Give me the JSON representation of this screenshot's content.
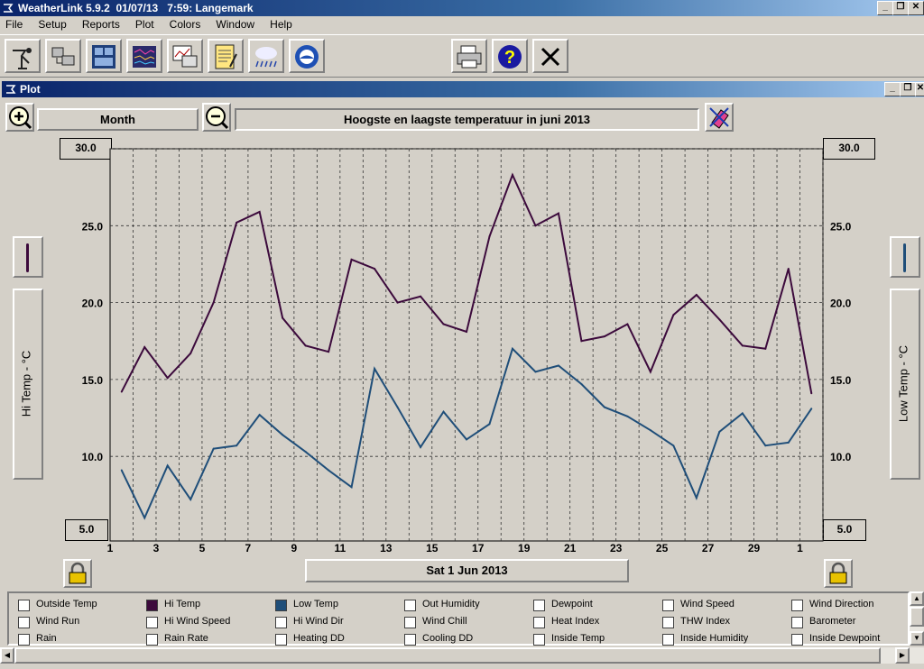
{
  "app": {
    "title": "WeatherLink 5.9.2  01/07/13   7:59: Langemark",
    "min_label": "_",
    "restore_label": "❐",
    "close_label": "✕"
  },
  "menu": [
    "File",
    "Setup",
    "Reports",
    "Plot",
    "Colors",
    "Window",
    "Help"
  ],
  "toolbar_icons": [
    "station-icon",
    "data-download-icon",
    "bulletin-icon",
    "strip-chart-icon",
    "plot-icon",
    "notepad-icon",
    "weather-rain-icon",
    "noaa-icon"
  ],
  "toolbar_right_icons": [
    "printer-icon",
    "help-icon",
    "close-icon"
  ],
  "plot_window": {
    "title": "Plot",
    "period_label": "Month",
    "chart_title": "Hoogste en laagste temperatuur in juni 2013",
    "date_label": "Sat 1 Jun 2013",
    "left_axis_label": "Hi Temp - °C",
    "right_axis_label": "Low Temp - °C"
  },
  "chart_data": {
    "type": "line",
    "title": "Hoogste en laagste temperatuur in juni 2013",
    "x": [
      1.5,
      2.5,
      3.5,
      4.5,
      5.5,
      6.5,
      7.5,
      8.5,
      9.5,
      10.5,
      11.5,
      12.5,
      13.5,
      14.5,
      15.5,
      16.5,
      17.5,
      18.5,
      19.5,
      20.5,
      21.5,
      22.5,
      23.5,
      24.5,
      25.5,
      26.5,
      27.5,
      28.5,
      29.5,
      30.5,
      31.5
    ],
    "xticks": [
      "1",
      "3",
      "5",
      "7",
      "9",
      "11",
      "13",
      "15",
      "17",
      "19",
      "21",
      "23",
      "25",
      "27",
      "29",
      "1"
    ],
    "xtick_positions": [
      1,
      3,
      5,
      7,
      9,
      11,
      13,
      15,
      17,
      19,
      21,
      23,
      25,
      27,
      29,
      31
    ],
    "xlim": [
      1,
      32
    ],
    "ylim": [
      4.5,
      30
    ],
    "yticks": [
      10.0,
      15.0,
      20.0,
      25.0
    ],
    "ybox_top": "30.0",
    "ybox_bottom": "5.0",
    "ylabel_left": "Hi Temp - °C",
    "ylabel_right": "Low Temp - °C",
    "grid": true,
    "series": [
      {
        "name": "Hi Temp",
        "color": "#3c0a3c",
        "values": [
          14.2,
          17.1,
          15.1,
          16.7,
          20.0,
          25.2,
          25.9,
          19.0,
          17.2,
          16.8,
          22.8,
          22.2,
          20.0,
          20.4,
          18.6,
          18.1,
          24.3,
          28.3,
          25.0,
          25.8,
          17.5,
          17.8,
          18.6,
          15.5,
          19.2,
          20.5,
          18.9,
          17.2,
          17.0,
          22.2,
          14.1
        ]
      },
      {
        "name": "Low Temp",
        "color": "#1f4e79",
        "values": [
          9.1,
          6.0,
          9.4,
          7.2,
          10.5,
          10.7,
          12.7,
          11.4,
          10.3,
          9.1,
          8.0,
          15.7,
          13.2,
          10.6,
          12.9,
          11.1,
          12.1,
          17.0,
          15.5,
          15.9,
          14.7,
          13.2,
          12.6,
          11.7,
          10.7,
          7.3,
          11.6,
          12.8,
          10.7,
          10.9,
          13.1
        ]
      }
    ]
  },
  "legend": [
    {
      "label": "Outside Temp",
      "checked": false,
      "color": ""
    },
    {
      "label": "Hi Temp",
      "checked": true,
      "color": "#3c0a3c"
    },
    {
      "label": "Low Temp",
      "checked": true,
      "color": "#1f4e79"
    },
    {
      "label": "Out Humidity",
      "checked": false,
      "color": ""
    },
    {
      "label": "Dewpoint",
      "checked": false,
      "color": ""
    },
    {
      "label": "Wind Speed",
      "checked": false,
      "color": ""
    },
    {
      "label": "Wind Direction",
      "checked": false,
      "color": ""
    },
    {
      "label": "Wind Run",
      "checked": false,
      "color": ""
    },
    {
      "label": "Hi Wind Speed",
      "checked": false,
      "color": ""
    },
    {
      "label": "Hi Wind Dir",
      "checked": false,
      "color": ""
    },
    {
      "label": "Wind Chill",
      "checked": false,
      "color": ""
    },
    {
      "label": "Heat Index",
      "checked": false,
      "color": ""
    },
    {
      "label": "THW Index",
      "checked": false,
      "color": ""
    },
    {
      "label": "Barometer",
      "checked": false,
      "color": ""
    },
    {
      "label": "Rain",
      "checked": false,
      "color": ""
    },
    {
      "label": "Rain Rate",
      "checked": false,
      "color": ""
    },
    {
      "label": "Heating DD",
      "checked": false,
      "color": ""
    },
    {
      "label": "Cooling DD",
      "checked": false,
      "color": ""
    },
    {
      "label": "Inside Temp",
      "checked": false,
      "color": ""
    },
    {
      "label": "Inside Humidity",
      "checked": false,
      "color": ""
    },
    {
      "label": "Inside Dewpoint",
      "checked": false,
      "color": ""
    }
  ],
  "colors": {
    "hi_temp": "#3c0a3c",
    "low_temp": "#1f4e79"
  }
}
